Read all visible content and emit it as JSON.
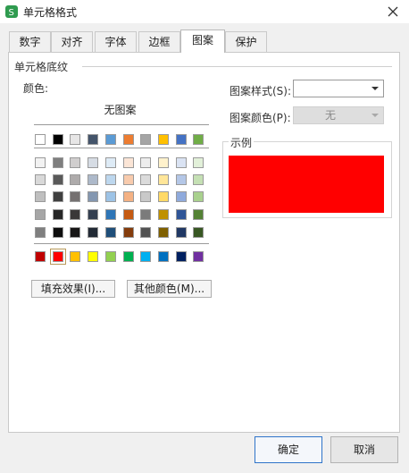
{
  "window": {
    "title": "单元格格式"
  },
  "tabs": [
    {
      "label": "数字"
    },
    {
      "label": "对齐"
    },
    {
      "label": "字体"
    },
    {
      "label": "边框"
    },
    {
      "label": "图案"
    },
    {
      "label": "保护"
    }
  ],
  "active_tab": "图案",
  "section": {
    "title": "单元格底纹"
  },
  "color_label": "颜色:",
  "no_pattern_label": "无图案",
  "palette": {
    "top_row": [
      "#ffffff",
      "#000000",
      "#e7e6e6",
      "#44546a",
      "#5b9bd5",
      "#ed7d31",
      "#a5a5a5",
      "#ffc000",
      "#4472c4",
      "#70ad47"
    ],
    "shade_rows": [
      [
        "#f2f2f2",
        "#7f7f7f",
        "#d0cece",
        "#d6dce4",
        "#deebf6",
        "#fbe5d6",
        "#ededed",
        "#fff2cc",
        "#dae3f3",
        "#e2f0d9"
      ],
      [
        "#d9d9d9",
        "#595959",
        "#aeabab",
        "#adb9ca",
        "#bdd7ee",
        "#f8cbad",
        "#dbdbdb",
        "#ffe699",
        "#b4c7e7",
        "#c5e0b4"
      ],
      [
        "#bfbfbf",
        "#3f3f3f",
        "#757171",
        "#8497b0",
        "#9dc3e6",
        "#f4b183",
        "#c9c9c9",
        "#ffd966",
        "#8faadc",
        "#a9d18e"
      ],
      [
        "#a6a6a6",
        "#262626",
        "#3a3838",
        "#333f50",
        "#2e75b6",
        "#c55a11",
        "#7b7b7b",
        "#bf9000",
        "#2f5597",
        "#548235"
      ],
      [
        "#7f7f7f",
        "#0d0d0d",
        "#171616",
        "#222a35",
        "#1f4e79",
        "#843c0c",
        "#525252",
        "#7f6000",
        "#203864",
        "#385723"
      ]
    ],
    "standard_row": [
      "#c00000",
      "#ff0000",
      "#ffc000",
      "#ffff00",
      "#92d050",
      "#00b050",
      "#00b0f0",
      "#0070c0",
      "#002060",
      "#7030a0"
    ],
    "selected_color": "#ff0000"
  },
  "buttons": {
    "fill_effects": "填充效果(I)...",
    "more_colors": "其他颜色(M)...",
    "ok": "确定",
    "cancel": "取消"
  },
  "pattern_style": {
    "label": "图案样式(S):",
    "value": ""
  },
  "pattern_color": {
    "label": "图案颜色(P):",
    "value": "无"
  },
  "sample": {
    "title": "示例",
    "color": "#ff0000"
  },
  "accent": {
    "app_icon": "#2f9b4f",
    "ok_border": "#2f74c9"
  }
}
